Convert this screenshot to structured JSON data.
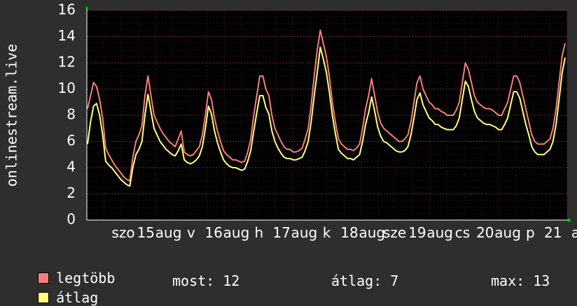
{
  "chart_data": {
    "type": "line",
    "ylabel": "onlinestream.live",
    "ylim": [
      0,
      16
    ],
    "yticks": [
      0,
      2,
      4,
      6,
      8,
      10,
      12,
      14,
      16
    ],
    "xtick_labels": [
      "szo",
      "15",
      "aug",
      "v",
      "16",
      "aug",
      "h",
      "17",
      "aug",
      "k",
      "18",
      "aug",
      "sze",
      "19",
      "aug",
      "cs",
      "20",
      "aug",
      "p",
      "21",
      "a"
    ],
    "grid": true,
    "legend_placement": "bottom-left",
    "series": [
      {
        "name": "legtöbb",
        "color": "#f77d7d",
        "values": [
          8.5,
          9.5,
          10.5,
          10.2,
          9.2,
          7.8,
          5.5,
          5.0,
          4.6,
          4.2,
          3.9,
          3.6,
          3.3,
          3.1,
          3.0,
          4.8,
          6.0,
          6.5,
          7.2,
          9.5,
          11.0,
          9.5,
          8.0,
          7.5,
          7.0,
          6.6,
          6.3,
          6.0,
          5.8,
          5.6,
          6.2,
          6.8,
          5.2,
          5.0,
          4.9,
          5.0,
          5.3,
          5.6,
          6.5,
          8.0,
          9.8,
          9.2,
          7.8,
          6.8,
          6.0,
          5.3,
          5.0,
          4.8,
          4.6,
          4.6,
          4.5,
          4.4,
          4.5,
          5.2,
          6.2,
          8.0,
          9.5,
          11.0,
          11.0,
          10.0,
          9.5,
          8.0,
          7.0,
          6.5,
          6.0,
          5.6,
          5.4,
          5.4,
          5.2,
          5.2,
          5.3,
          5.5,
          6.2,
          7.0,
          8.8,
          11.0,
          13.0,
          14.5,
          13.5,
          12.5,
          11.0,
          9.0,
          7.5,
          6.2,
          5.8,
          5.6,
          5.4,
          5.4,
          5.3,
          5.5,
          5.8,
          7.0,
          8.5,
          9.5,
          10.8,
          9.5,
          8.2,
          7.4,
          7.0,
          6.8,
          6.6,
          6.4,
          6.2,
          6.0,
          6.0,
          6.2,
          6.5,
          7.5,
          9.0,
          10.5,
          11.0,
          10.0,
          9.5,
          9.0,
          8.8,
          8.5,
          8.5,
          8.3,
          8.2,
          8.0,
          8.0,
          8.0,
          8.4,
          9.0,
          10.5,
          12.0,
          11.5,
          10.5,
          9.5,
          9.0,
          8.8,
          8.6,
          8.5,
          8.5,
          8.4,
          8.2,
          8.0,
          8.0,
          8.5,
          9.0,
          10.0,
          11.0,
          11.0,
          10.5,
          9.5,
          8.5,
          7.5,
          6.5,
          6.0,
          5.8,
          5.8,
          5.8,
          6.0,
          6.2,
          7.0,
          8.5,
          10.5,
          12.5,
          13.5
        ],
        "x_start": 125,
        "x_end": 807
      },
      {
        "name": "átlag",
        "color": "#ffff80",
        "values": [
          5.8,
          7.5,
          8.7,
          8.9,
          8.0,
          6.5,
          4.5,
          4.2,
          4.0,
          3.7,
          3.4,
          3.1,
          2.9,
          2.7,
          2.6,
          4.0,
          5.0,
          5.4,
          6.0,
          8.0,
          9.6,
          8.3,
          7.0,
          6.5,
          6.0,
          5.7,
          5.4,
          5.2,
          5.0,
          4.9,
          5.3,
          5.8,
          4.6,
          4.4,
          4.3,
          4.4,
          4.6,
          4.9,
          5.6,
          7.0,
          8.7,
          8.1,
          6.8,
          5.9,
          5.2,
          4.6,
          4.3,
          4.1,
          4.0,
          4.0,
          3.9,
          3.8,
          3.9,
          4.5,
          5.3,
          6.8,
          8.2,
          9.5,
          9.5,
          8.6,
          8.1,
          6.8,
          6.0,
          5.5,
          5.1,
          4.8,
          4.7,
          4.7,
          4.6,
          4.6,
          4.7,
          4.8,
          5.3,
          6.0,
          7.5,
          9.5,
          11.3,
          13.2,
          12.3,
          11.3,
          9.8,
          8.0,
          6.6,
          5.4,
          5.1,
          4.9,
          4.7,
          4.7,
          4.6,
          4.8,
          5.0,
          6.0,
          7.3,
          8.2,
          9.4,
          8.3,
          7.1,
          6.4,
          6.0,
          5.9,
          5.7,
          5.5,
          5.3,
          5.2,
          5.2,
          5.3,
          5.6,
          6.5,
          7.8,
          9.2,
          9.7,
          8.8,
          8.3,
          7.8,
          7.6,
          7.3,
          7.3,
          7.1,
          7.0,
          6.9,
          6.9,
          6.9,
          7.2,
          7.8,
          9.2,
          10.6,
          10.2,
          9.2,
          8.3,
          7.8,
          7.6,
          7.4,
          7.3,
          7.3,
          7.2,
          7.1,
          6.9,
          6.9,
          7.3,
          7.8,
          8.8,
          9.8,
          9.8,
          9.3,
          8.3,
          7.3,
          6.5,
          5.6,
          5.2,
          5.0,
          5.0,
          5.0,
          5.2,
          5.4,
          6.0,
          7.3,
          9.2,
          11.2,
          12.4
        ],
        "x_start": 125,
        "x_end": 807
      }
    ]
  },
  "legend": [
    {
      "label": "legtöbb",
      "color": "#f77d7d"
    },
    {
      "label": "átlag",
      "color": "#ffff80"
    }
  ],
  "stats": {
    "most": "most: 12",
    "atlag": "átlag: 7",
    "max": "max: 13"
  }
}
